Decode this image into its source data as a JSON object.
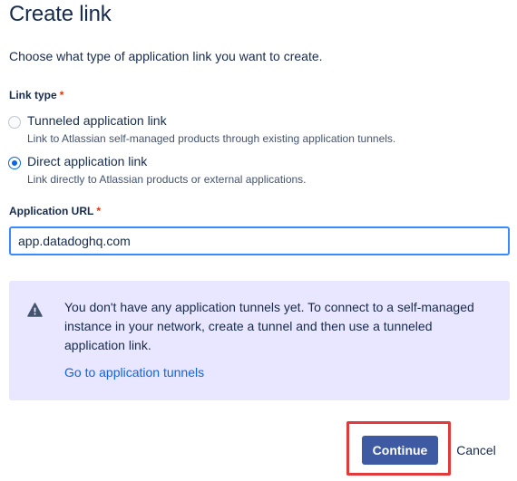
{
  "dialog": {
    "title": "Create link",
    "intro": "Choose what type of application link you want to create."
  },
  "link_type": {
    "label": "Link type",
    "required_mark": "*",
    "options": [
      {
        "label": "Tunneled application link",
        "description": "Link to Atlassian self-managed products through existing application tunnels.",
        "selected": false
      },
      {
        "label": "Direct application link",
        "description": "Link directly to Atlassian products or external applications.",
        "selected": true
      }
    ]
  },
  "application_url": {
    "label": "Application URL",
    "required_mark": "*",
    "value": "app.datadoghq.com"
  },
  "notice": {
    "icon": "warning-icon",
    "text": "You don't have any application tunnels yet. To connect to a self-managed instance in your network, create a tunnel and then use a tunneled application link.",
    "link": "Go to application tunnels",
    "background": "#e9e6ff"
  },
  "actions": {
    "continue_label": "Continue",
    "cancel_label": "Cancel",
    "primary_color": "#3e5aa2",
    "highlight_color": "#e03a3a"
  }
}
